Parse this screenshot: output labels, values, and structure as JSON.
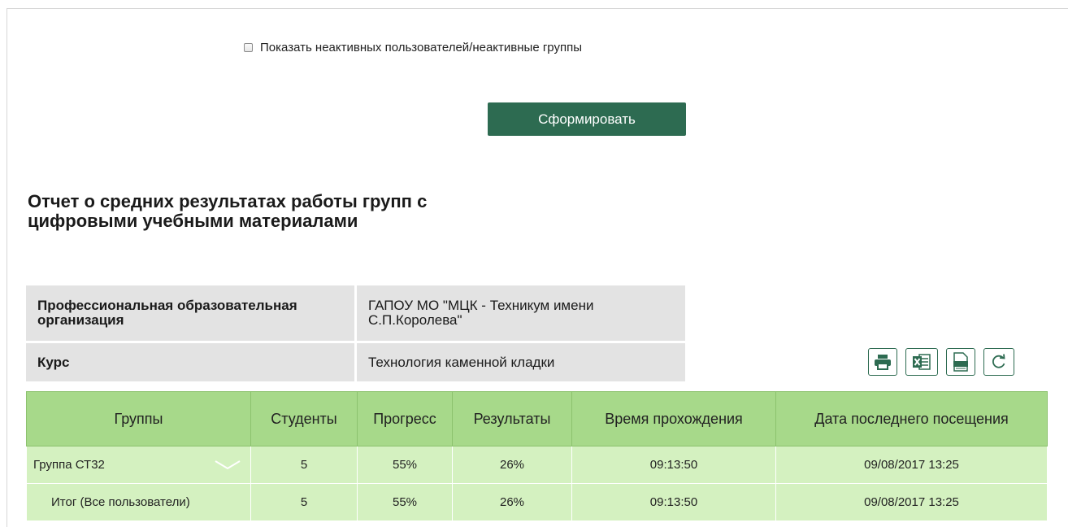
{
  "filters": {
    "show_inactive_label": "Показать неактивных пользователей/неактивные группы",
    "show_inactive_checked": false
  },
  "actions": {
    "generate_label": "Сформировать"
  },
  "report": {
    "title": "Отчет о средних результатах работы групп с цифровыми учебными материалами",
    "info": [
      {
        "label": "Профессиональная образовательная организация",
        "value": "ГАПОУ МО \"МЦК - Техникум имени С.П.Королева\""
      },
      {
        "label": "Курс",
        "value": "Технология каменной кладки"
      }
    ]
  },
  "toolbar": {
    "icons": [
      "print-icon",
      "excel-icon",
      "pdf-icon",
      "refresh-icon"
    ]
  },
  "table": {
    "headers": [
      "Группы",
      "Студенты",
      "Прогресс",
      "Результаты",
      "Время прохождения",
      "Дата последнего посещения"
    ],
    "rows": [
      [
        "Группа СТ32",
        "5",
        "55%",
        "26%",
        "09:13:50",
        "09/08/2017 13:25"
      ],
      [
        "Итог (Все пользователи)",
        "5",
        "55%",
        "26%",
        "09:13:50",
        "09/08/2017 13:25"
      ]
    ]
  },
  "colors": {
    "accent": "#2d6b51",
    "header_green": "#a7d98a",
    "row_green": "#d4f1c0",
    "info_gray": "#e3e3e3"
  }
}
